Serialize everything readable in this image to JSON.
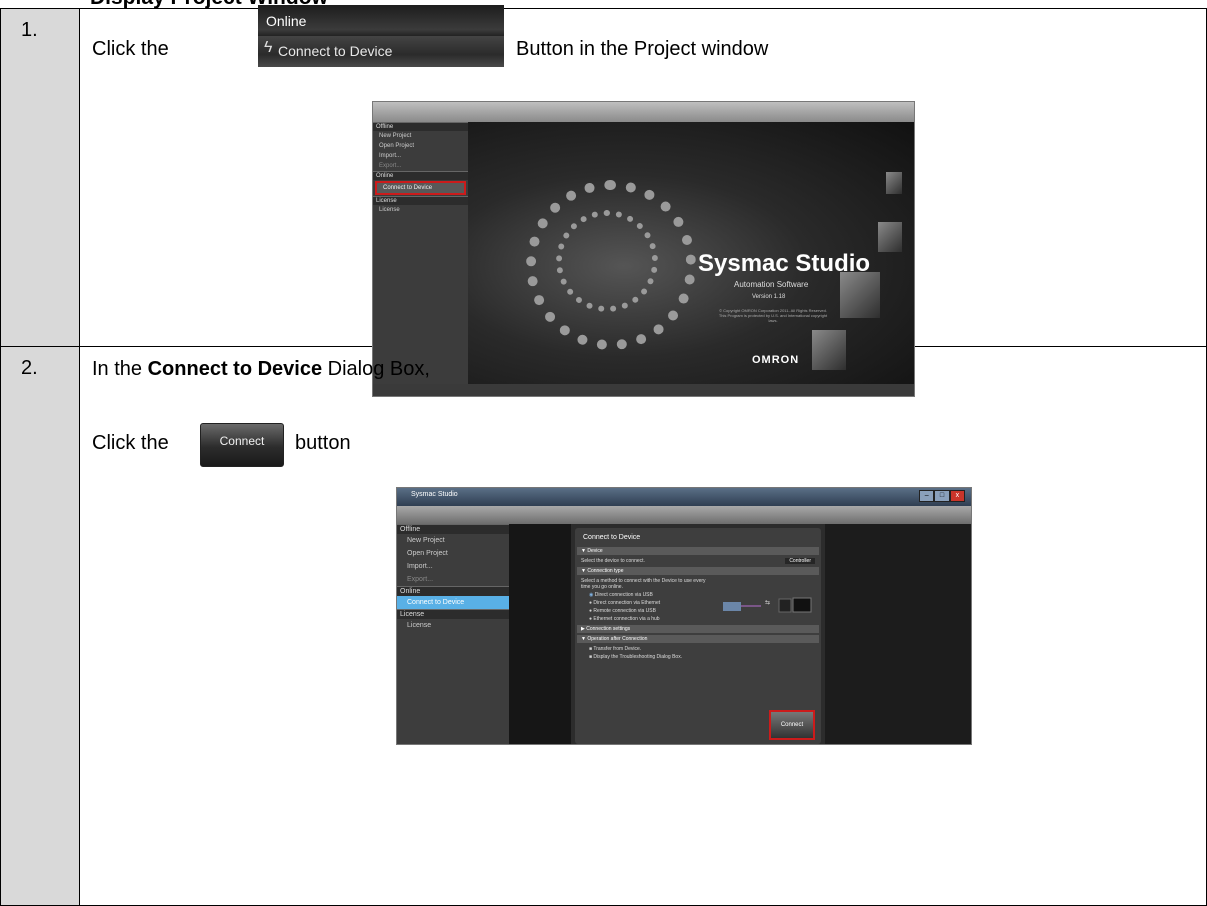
{
  "doc_title": "Display Project Window",
  "steps": [
    {
      "number": "1.",
      "text_before": "Click the",
      "text_after": "Button in the Project window",
      "inline_button": {
        "group_label": "Online",
        "label": "Connect to Device"
      },
      "screenshot": {
        "sidebar": {
          "offline_header": "Offline",
          "items": [
            "New Project",
            "Open Project",
            "Import...",
            "Export..."
          ],
          "online_header": "Online",
          "online_item": "Connect to Device",
          "license_header": "License",
          "license_item": "License"
        },
        "splash": {
          "title": "Sysmac Studio",
          "subtitle": "Automation Software",
          "version": "Version 1.18",
          "copyright": "© Copyright OMRON Corporation 2011-  All Rights Reserved.  This Program is protected by U.S. and International copyright laws.",
          "logo": "OMRON"
        }
      }
    },
    {
      "number": "2.",
      "line1_before": "In the",
      "line1_bold": "Connect to Device",
      "line1_after": "Dialog Box,",
      "line2_before": "Click the",
      "line2_after": "button",
      "inline_button": {
        "label": "Connect"
      },
      "screenshot": {
        "window_title": "Sysmac Studio",
        "sidebar": {
          "offline_header": "Offline",
          "items": [
            "New Project",
            "Open Project",
            "Import...",
            "Export..."
          ],
          "online_header": "Online",
          "online_item": "Connect to Device",
          "license_header": "License",
          "license_item": "License"
        },
        "dialog": {
          "title": "Connect to Device",
          "device_header": "▼ Device",
          "device_prompt": "Select the device to connect.",
          "device_value": "Controller",
          "conn_type_header": "▼ Connection type",
          "conn_type_desc": "Select a method to connect with the Device to use every time you go online.",
          "options": [
            "Direct connection via USB",
            "Direct connection via Ethernet",
            "Remote connection via USB",
            "Ethernet connection via a hub"
          ],
          "settings_header": "▶ Connection settings",
          "after_header": "▼ Operation after Connection",
          "checks": [
            "Transfer from Device.",
            "Display the Troubleshooting Dialog Box."
          ],
          "connect_button": "Connect"
        }
      }
    }
  ]
}
